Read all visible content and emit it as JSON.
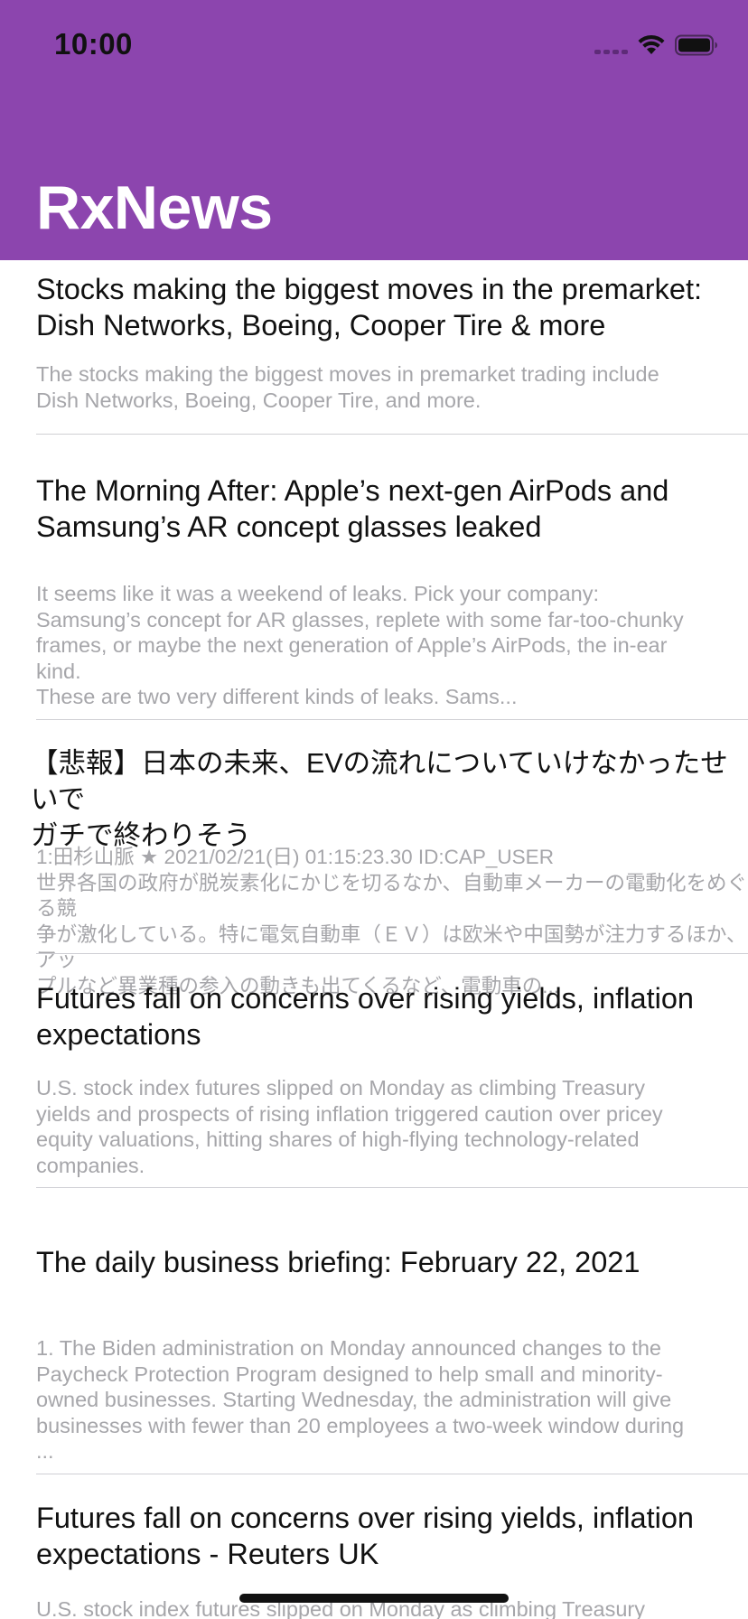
{
  "status_bar": {
    "time": "10:00",
    "signal_icon": "cellular-signal-icon",
    "wifi_icon": "wifi-icon",
    "battery_icon": "battery-full-icon"
  },
  "nav": {
    "title": "RxNews",
    "background_color": "#8c45ae"
  },
  "articles": [
    {
      "title": "Stocks making the biggest moves in the premarket:\nDish Networks, Boeing, Cooper Tire & more",
      "description": "The stocks making the biggest moves in premarket trading include\nDish Networks, Boeing, Cooper Tire, and more."
    },
    {
      "title": "The Morning After: Apple’s next-gen AirPods and\nSamsung’s AR concept glasses leaked",
      "description": "It seems like it was a weekend of leaks. Pick your company:\nSamsung’s concept for AR glasses, replete with some far-too-chunky\nframes, or maybe the next generation of Apple’s AirPods, the in-ear\nkind.\nThese are two very different kinds of leaks. Sams..."
    },
    {
      "title": "【悲報】日本の未来、EVの流れについていけなかったせいで\nガチで終わりそう",
      "description": "1:田杉山脈 ★ 2021/02/21(日) 01:15:23.30 ID:CAP_USER\n 世界各国の政府が脱炭素化にかじを切るなか、自動車メーカーの電動化をめぐる競\n争が激化している。特に電気自動車（ＥＶ）は欧米や中国勢が注力するほか、アッ\nプルなど異業種の参入の動きも出てくるなど、電動車の..."
    },
    {
      "title": "Futures fall on concerns over rising yields, inflation\nexpectations",
      "description": "U.S. stock index futures slipped on Monday as climbing Treasury\nyields and prospects of rising inflation triggered caution over pricey\nequity valuations, hitting shares of high-flying technology-related\ncompanies."
    },
    {
      "title": "The daily business briefing: February 22, 2021",
      "description": "1. The Biden administration on Monday announced changes to the\nPaycheck Protection Program designed to help small and minority-\nowned businesses. Starting Wednesday, the administration will give\nbusinesses with fewer than 20 employees a two-week window during\n..."
    },
    {
      "title": "Futures fall on concerns over rising yields, inflation\nexpectations - Reuters UK",
      "description": "U.S. stock index futures slipped on Monday as climbing Treasury"
    }
  ]
}
